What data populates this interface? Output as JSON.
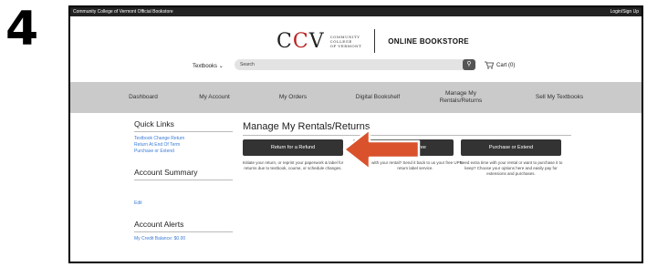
{
  "step_number": "4",
  "topbar": {
    "left": "Community College of Vermont Official Bookstore",
    "right": "Login/Sign Up"
  },
  "logo": {
    "mark_left": "C",
    "mark_mid": "C",
    "mark_right": "V",
    "college_lines": [
      "COMMUNITY",
      "COLLEGE",
      "OF VERMONT"
    ],
    "store_name": "ONLINE BOOKSTORE"
  },
  "header": {
    "textbooks_label": "Textbooks",
    "search_placeholder": "Search",
    "cart_label": "Cart (0)"
  },
  "nav": {
    "items": [
      "Dashboard",
      "My Account",
      "My Orders",
      "Digital Bookshelf",
      "Manage My Rentals/Returns",
      "Sell My Textbooks"
    ],
    "manage_line1": "Manage My",
    "manage_line2": "Rentals/Returns"
  },
  "sidebar": {
    "quick_links_title": "Quick Links",
    "quick_links": [
      "Textbook Change Return",
      "Return At End Of Term",
      "Purchase or Extend"
    ],
    "account_summary_title": "Account Summary",
    "edit_label": "Edit",
    "account_alerts_title": "Account Alerts",
    "credit_balance": "My Credit Balance: $0.00"
  },
  "main": {
    "title": "Manage My Rentals/Returns",
    "cards": [
      {
        "button": "Return for a Refund",
        "desc": "Initiate your return, or reprint your paperwork & label for returns due to textbook, course, or schedule changes."
      },
      {
        "button": "al for Free",
        "desc": "d with your rental? Send it back to us your free UPS return label service."
      },
      {
        "button": "Purchase or Extend",
        "desc": "Need extra time with your rental or want to purchase it to keep? Choose your options here and easily pay for extensions and purchases."
      }
    ]
  },
  "colors": {
    "arrow": "#d9522c",
    "nav_bg": "#c9cac9",
    "button_bg": "#333333",
    "link": "#3a7bd5"
  }
}
